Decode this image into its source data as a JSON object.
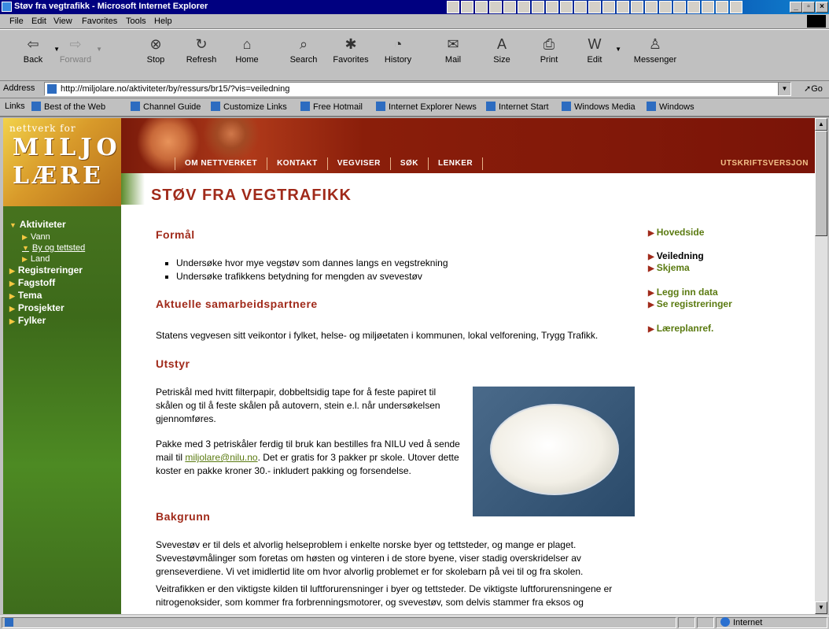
{
  "window": {
    "title": "Støv fra vegtrafikk - Microsoft Internet Explorer",
    "controls": [
      "_",
      "▫",
      "×"
    ]
  },
  "menu": [
    "File",
    "Edit",
    "View",
    "Favorites",
    "Tools",
    "Help"
  ],
  "toolbar": [
    {
      "label": "Back",
      "icon": "back-arrow-icon",
      "enabled": true
    },
    {
      "label": "Forward",
      "icon": "forward-arrow-icon",
      "enabled": false
    },
    {
      "label": "Stop",
      "icon": "stop-icon",
      "enabled": true
    },
    {
      "label": "Refresh",
      "icon": "refresh-icon",
      "enabled": true
    },
    {
      "label": "Home",
      "icon": "home-icon",
      "enabled": true
    },
    {
      "label": "Search",
      "icon": "search-icon",
      "enabled": true
    },
    {
      "label": "Favorites",
      "icon": "favorites-icon",
      "enabled": true
    },
    {
      "label": "History",
      "icon": "history-icon",
      "enabled": true
    },
    {
      "label": "Mail",
      "icon": "mail-icon",
      "enabled": true
    },
    {
      "label": "Size",
      "icon": "font-size-icon",
      "enabled": true
    },
    {
      "label": "Print",
      "icon": "printer-icon",
      "enabled": true
    },
    {
      "label": "Edit",
      "icon": "edit-icon",
      "enabled": true
    },
    {
      "label": "Messenger",
      "icon": "messenger-icon",
      "enabled": true
    }
  ],
  "address": {
    "label": "Address",
    "url": "http://miljolare.no/aktiviteter/by/ressurs/br15/?vis=veiledning",
    "go": "Go"
  },
  "links": {
    "label": "Links",
    "items": [
      "Best of the Web",
      "Channel Guide",
      "Customize Links",
      "Free Hotmail",
      "Internet Explorer News",
      "Internet Start",
      "Windows Media",
      "Windows"
    ]
  },
  "site": {
    "logo": {
      "line1": "nettverk for",
      "line2": "MILJO",
      "line3": "LÆRE"
    },
    "topnav": [
      "OM NETTVERKET",
      "KONTAKT",
      "VEGVISER",
      "SØK",
      "LENKER"
    ],
    "print_version": "UTSKRIFTSVERSJON",
    "sidenav": [
      {
        "label": "Aktiviteter",
        "level": 1,
        "expanded": true
      },
      {
        "label": "Vann",
        "level": 2
      },
      {
        "label": "By og tettsted",
        "level": 2,
        "selected": true
      },
      {
        "label": "Land",
        "level": 2
      },
      {
        "label": "Registreringer",
        "level": 1
      },
      {
        "label": "Fagstoff",
        "level": 1
      },
      {
        "label": "Tema",
        "level": 1
      },
      {
        "label": "Prosjekter",
        "level": 1
      },
      {
        "label": "Fylker",
        "level": 1
      }
    ],
    "rightnav": [
      "Hovedside",
      "Veiledning",
      "Skjema",
      "Legg inn data",
      "Se registreringer",
      "Læreplanref."
    ]
  },
  "content": {
    "title": "STØV FRA VEGTRAFIKK",
    "sections": {
      "formal": {
        "heading": "Formål",
        "bullets": [
          "Undersøke hvor mye vegstøv som dannes langs en vegstrekning",
          "Undersøke trafikkens betydning for mengden av svevestøv"
        ]
      },
      "partners": {
        "heading": "Aktuelle samarbeidspartnere",
        "text": "Statens vegvesen sitt veikontor i fylket, helse- og miljøetaten i kommunen, lokal velforening, Trygg Trafikk."
      },
      "utstyr": {
        "heading": "Utstyr",
        "p1": "Petriskål med hvitt filterpapir, dobbeltsidig tape for å feste papiret til skålen og til å feste skålen på autovern, stein e.l. når undersøkelsen gjennomføres.",
        "p2_before": "Pakke med 3 petriskåler ferdig til bruk kan bestilles fra NILU ved å sende mail til ",
        "email": "miljolare@nilu.no",
        "p2_after": ". Det er gratis for 3 pakker pr skole. Utover dette koster en pakke kroner 30.- inkludert pakking og forsendelse."
      },
      "bakgrunn": {
        "heading": "Bakgrunn",
        "p1": "Svevestøv er til dels et alvorlig helseproblem i enkelte norske byer og tettsteder, og mange er plaget. Svevestøvmålinger som foretas om høsten og vinteren i de store byene, viser stadig overskridelser av grenseverdiene. Vi vet imidlertid lite om hvor alvorlig problemet er for skolebarn på vei til og fra skolen.",
        "p2": "Veitrafikken er den viktigste kilden til luftforurensninger i byer og tettsteder. De viktigste luftforurensningene er nitrogenoksider, som kommer fra forbrenningsmotorer, og svevestøv, som delvis stammer fra eksos og"
      }
    }
  },
  "status": {
    "zone": "Internet"
  }
}
